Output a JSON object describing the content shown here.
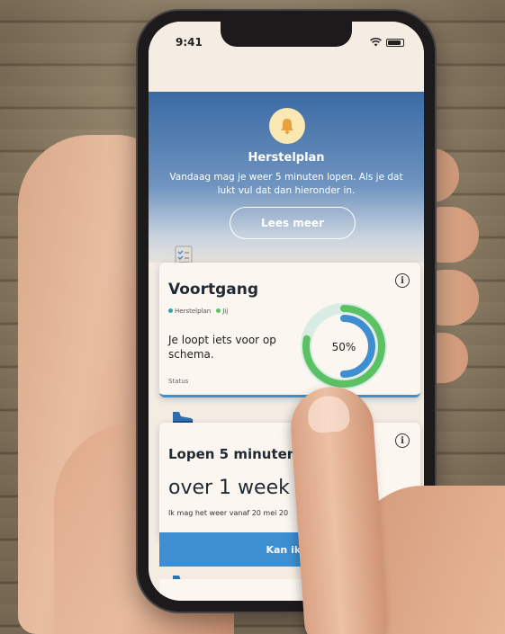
{
  "status_bar": {
    "time": "9:41"
  },
  "hero": {
    "icon": "bell-icon",
    "title": "Herstelplan",
    "text": "Vandaag mag je weer 5 minuten lopen. Als je dat lukt vul dat dan hieronder in.",
    "button_label": "Lees meer"
  },
  "progress_card": {
    "icon": "checklist-icon",
    "title": "Voortgang",
    "legend": [
      {
        "label": "Herstelplan",
        "color": "#2aa7a0"
      },
      {
        "label": "Jij",
        "color": "#5cc163"
      }
    ],
    "text": "Je loopt iets voor op schema.",
    "status_label": "Status",
    "percent_label": "50%",
    "percent": 50
  },
  "walk_card": {
    "icon": "shoe-icon",
    "title": "Lopen 5 minuten",
    "big_text": "over 1 week",
    "sub_text": "Ik mag het weer vanaf 20 mei 20",
    "button_label": "Kan ik weer"
  },
  "colors": {
    "accent_blue": "#3d8fd1",
    "hero_blue": "#3a6aa4",
    "green": "#5cc163"
  }
}
